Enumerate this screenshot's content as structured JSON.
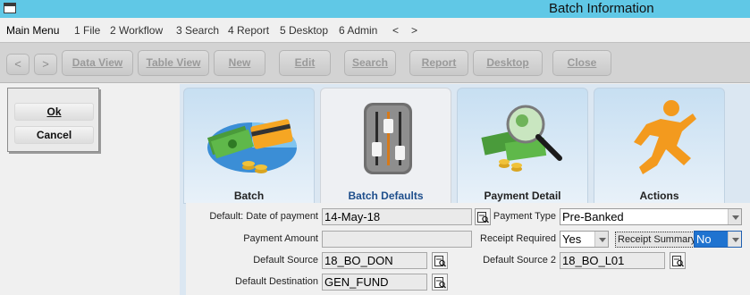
{
  "window": {
    "title": "Batch Information"
  },
  "menu": {
    "items": [
      "Main Menu",
      "1 File",
      "2 Workflow",
      "3 Search",
      "4 Report",
      "5 Desktop",
      "6 Admin",
      "<",
      ">"
    ]
  },
  "toolbar": {
    "back": "<",
    "forward": ">",
    "buttons": [
      "Data View",
      "Table View",
      "New",
      "Edit",
      "Search",
      "Report",
      "Desktop",
      "Close"
    ]
  },
  "dialog": {
    "ok": "Ok",
    "cancel": "Cancel"
  },
  "tiles": [
    {
      "label": "Batch",
      "icon": "money-card-pie-icon"
    },
    {
      "label": "Batch Defaults",
      "icon": "sliders-icon"
    },
    {
      "label": "Payment Detail",
      "icon": "money-magnifier-icon"
    },
    {
      "label": "Actions",
      "icon": "running-man-icon"
    }
  ],
  "form": {
    "date_label": "Default: Date of payment",
    "date_value": "14-May-18",
    "amount_label": "Payment Amount",
    "amount_value": "",
    "source_label": "Default Source",
    "source_value": "18_BO_DON",
    "destination_label": "Default Destination",
    "destination_value": "GEN_FUND",
    "payment_type_label": "Payment Type",
    "payment_type_value": "Pre-Banked",
    "receipt_required_label": "Receipt Required",
    "receipt_required_value": "Yes",
    "receipt_summary_label": "Receipt Summary",
    "receipt_summary_value": "No",
    "source2_label": "Default Source 2",
    "source2_value": "18_BO_L01"
  },
  "colors": {
    "titlebar": "#60c8e6",
    "selected": "#1f73d0",
    "tile_panel": "#dbe7f2"
  }
}
